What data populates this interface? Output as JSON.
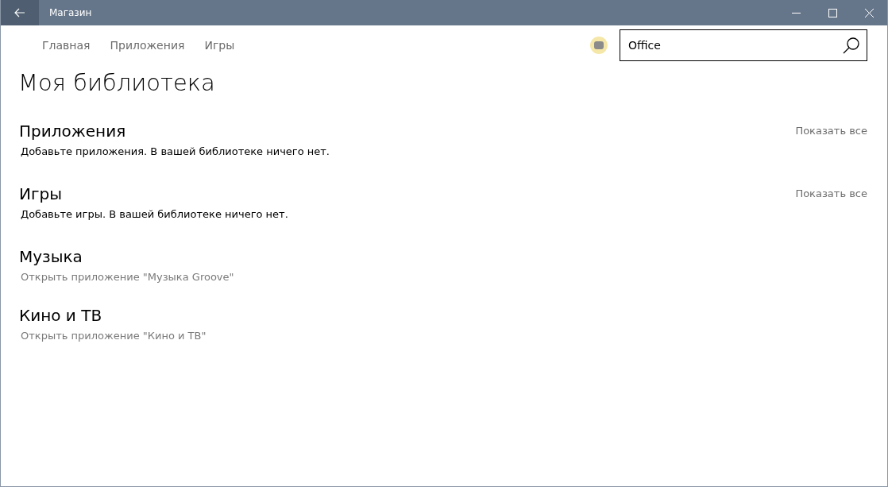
{
  "window": {
    "title": "Магазин"
  },
  "nav": {
    "tabs": [
      {
        "label": "Главная"
      },
      {
        "label": "Приложения"
      },
      {
        "label": "Игры"
      }
    ]
  },
  "search": {
    "value": "Office"
  },
  "page_title": "Моя библиотека",
  "sections": [
    {
      "title": "Приложения",
      "show_all": "Показать все",
      "kind": "message",
      "text": "Добавьте приложения. В вашей библиотеке ничего нет."
    },
    {
      "title": "Игры",
      "show_all": "Показать все",
      "kind": "message",
      "text": "Добавьте игры. В вашей библиотеке ничего нет."
    },
    {
      "title": "Музыка",
      "kind": "link",
      "text": "Открыть приложение \"Музыка Groove\""
    },
    {
      "title": "Кино и ТВ",
      "kind": "link",
      "text": "Открыть приложение \"Кино и ТВ\""
    }
  ]
}
